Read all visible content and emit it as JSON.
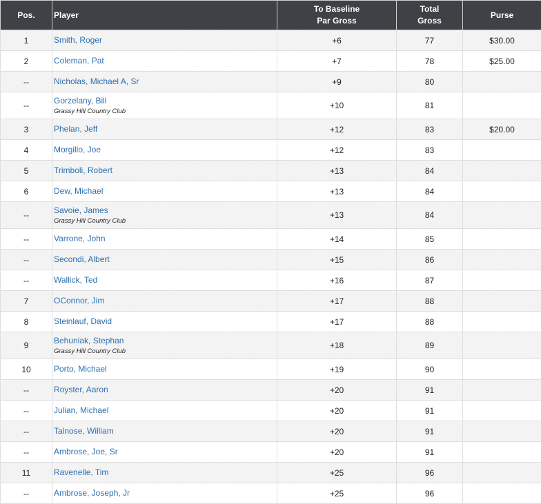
{
  "headers": {
    "pos": "Pos.",
    "player": "Player",
    "par_line1": "To Baseline",
    "par_line2": "Par Gross",
    "total_line1": "Total",
    "total_line2": "Gross",
    "purse": "Purse"
  },
  "rows": [
    {
      "pos": "1",
      "name": "Smith, Roger",
      "club": "",
      "par": "+6",
      "total": "77",
      "purse": "$30.00"
    },
    {
      "pos": "2",
      "name": "Coleman, Pat",
      "club": "",
      "par": "+7",
      "total": "78",
      "purse": "$25.00"
    },
    {
      "pos": "--",
      "name": "Nicholas, Michael A, Sr",
      "club": "",
      "par": "+9",
      "total": "80",
      "purse": ""
    },
    {
      "pos": "--",
      "name": "Gorzelany, Bill",
      "club": "Grassy Hill Country Club",
      "par": "+10",
      "total": "81",
      "purse": ""
    },
    {
      "pos": "3",
      "name": "Phelan, Jeff",
      "club": "",
      "par": "+12",
      "total": "83",
      "purse": "$20.00"
    },
    {
      "pos": "4",
      "name": "Morgillo, Joe",
      "club": "",
      "par": "+12",
      "total": "83",
      "purse": ""
    },
    {
      "pos": "5",
      "name": "Trimboli, Robert",
      "club": "",
      "par": "+13",
      "total": "84",
      "purse": ""
    },
    {
      "pos": "6",
      "name": "Dew, Michael",
      "club": "",
      "par": "+13",
      "total": "84",
      "purse": ""
    },
    {
      "pos": "--",
      "name": "Savoie, James",
      "club": "Grassy Hill Country Club",
      "par": "+13",
      "total": "84",
      "purse": ""
    },
    {
      "pos": "--",
      "name": "Varrone, John",
      "club": "",
      "par": "+14",
      "total": "85",
      "purse": ""
    },
    {
      "pos": "--",
      "name": "Secondi, Albert",
      "club": "",
      "par": "+15",
      "total": "86",
      "purse": ""
    },
    {
      "pos": "--",
      "name": "Wallick, Ted",
      "club": "",
      "par": "+16",
      "total": "87",
      "purse": ""
    },
    {
      "pos": "7",
      "name": "OConnor, Jim",
      "club": "",
      "par": "+17",
      "total": "88",
      "purse": ""
    },
    {
      "pos": "8",
      "name": "Steinlauf, David",
      "club": "",
      "par": "+17",
      "total": "88",
      "purse": ""
    },
    {
      "pos": "9",
      "name": "Behuniak, Stephan",
      "club": "Grassy Hill Country Club",
      "par": "+18",
      "total": "89",
      "purse": ""
    },
    {
      "pos": "10",
      "name": "Porto, Michael",
      "club": "",
      "par": "+19",
      "total": "90",
      "purse": ""
    },
    {
      "pos": "--",
      "name": "Royster, Aaron",
      "club": "",
      "par": "+20",
      "total": "91",
      "purse": ""
    },
    {
      "pos": "--",
      "name": "Julian, Michael",
      "club": "",
      "par": "+20",
      "total": "91",
      "purse": ""
    },
    {
      "pos": "--",
      "name": "Talnose, William",
      "club": "",
      "par": "+20",
      "total": "91",
      "purse": ""
    },
    {
      "pos": "--",
      "name": "Ambrose, Joe, Sr",
      "club": "",
      "par": "+20",
      "total": "91",
      "purse": ""
    },
    {
      "pos": "11",
      "name": "Ravenelle, Tim",
      "club": "",
      "par": "+25",
      "total": "96",
      "purse": ""
    },
    {
      "pos": "--",
      "name": "Ambrose, Joseph, Jr",
      "club": "",
      "par": "+25",
      "total": "96",
      "purse": ""
    }
  ]
}
